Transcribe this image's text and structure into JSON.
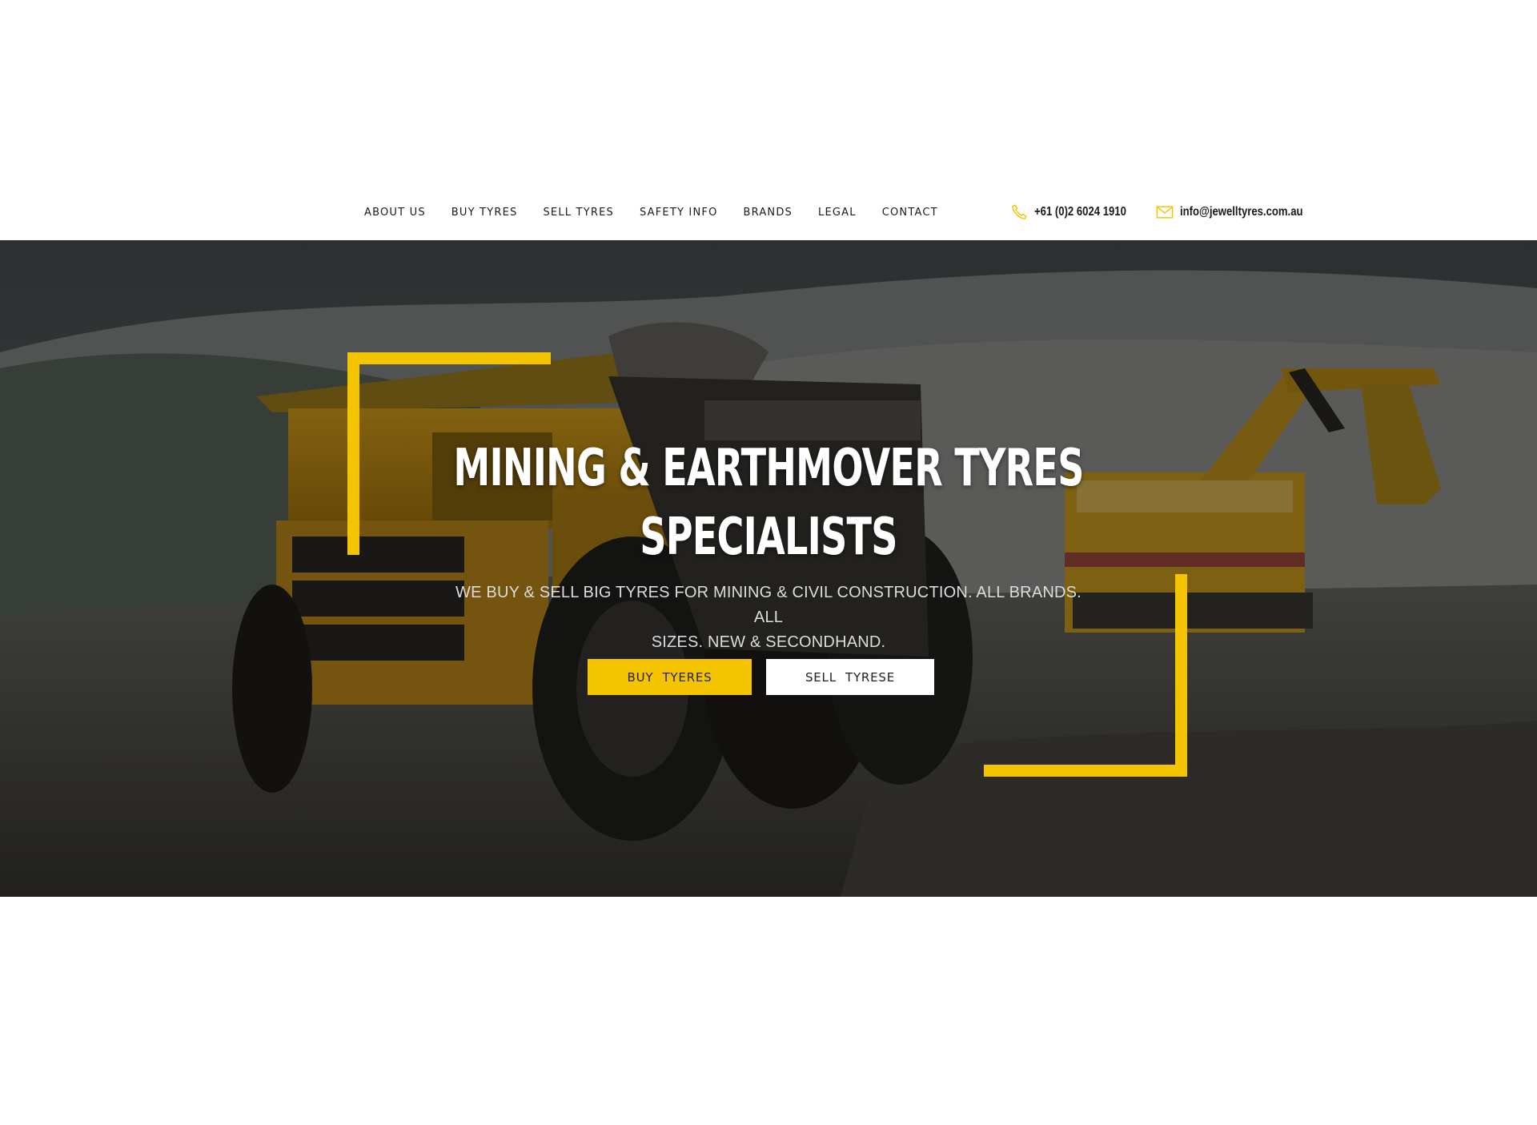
{
  "nav": {
    "items": [
      {
        "label": "ABOUT US"
      },
      {
        "label": "BUY TYRES"
      },
      {
        "label": "SELL TYRES"
      },
      {
        "label": "SAFETY INFO"
      },
      {
        "label": "BRANDS"
      },
      {
        "label": "LEGAL"
      },
      {
        "label": "CONTACT"
      }
    ],
    "phone": "+61 (0)2 6024 1910",
    "email": "info@jewelltyres.com.au",
    "phone_icon": "phone-icon",
    "email_icon": "envelope-icon"
  },
  "hero": {
    "title_line1": "MINING & EARTHMOVER TYRES",
    "title_line2": "SPECIALISTS",
    "subtitle_line1": "WE BUY & SELL BIG TYRES FOR MINING & CIVIL CONSTRUCTION. ALL BRANDS. ALL",
    "subtitle_line2": "SIZES. NEW & SECONDHAND.",
    "buy_button": "BUY  TYERES",
    "sell_button": "SELL  TYRESE",
    "background_description_icon": "mining-dump-truck-image"
  },
  "colors": {
    "accent": "#f5c400",
    "text_dark": "#1a1a1a",
    "white": "#ffffff"
  }
}
